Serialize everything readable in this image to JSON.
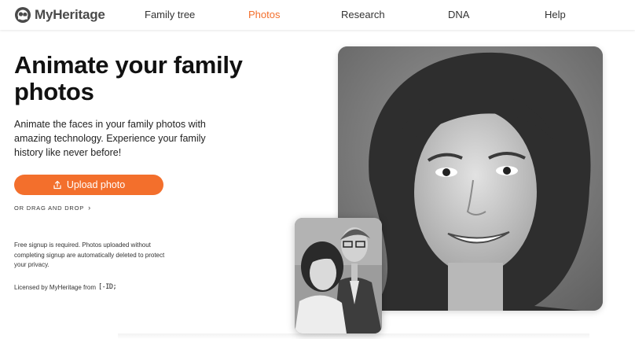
{
  "brand": {
    "name": "MyHeritage"
  },
  "nav": {
    "items": [
      {
        "label": "Family tree",
        "active": false
      },
      {
        "label": "Photos",
        "active": true
      },
      {
        "label": "Research",
        "active": false
      },
      {
        "label": "DNA",
        "active": false
      },
      {
        "label": "Help",
        "active": false
      }
    ]
  },
  "hero": {
    "title": "Animate your family photos",
    "subtitle": "Animate the faces in your family photos with amazing technology. Experience your family history like never before!",
    "upload_label": "Upload photo",
    "drag_drop_label": "OR DRAG AND DROP",
    "fineprint": "Free signup is required. Photos uploaded without completing signup are automatically deleted to protect your privacy.",
    "license_text": "Licensed by MyHeritage from",
    "license_partner": "D-ID"
  },
  "colors": {
    "accent": "#f36f2c",
    "text": "#111111"
  }
}
